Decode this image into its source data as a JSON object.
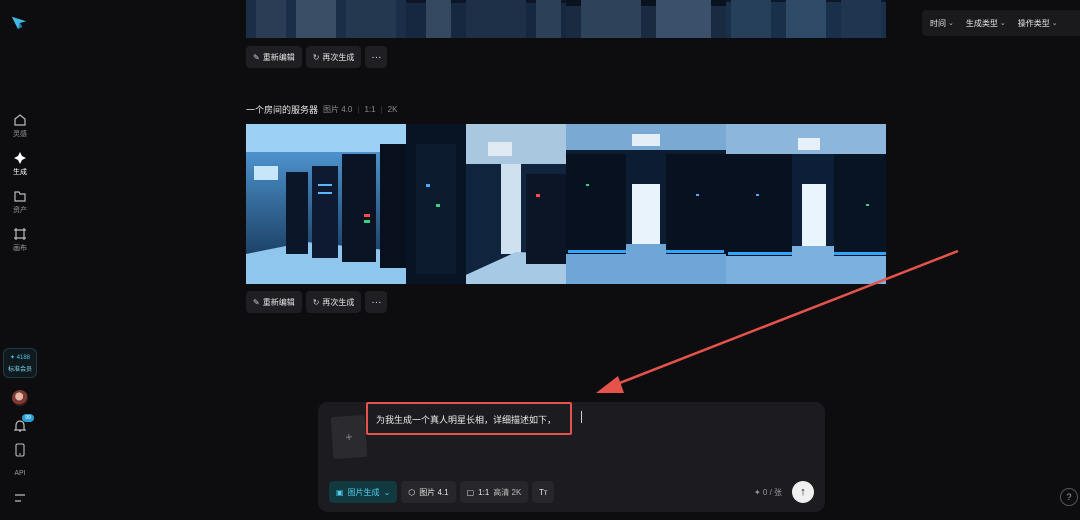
{
  "sidebar": {
    "items": [
      {
        "label": "灵感",
        "icon": "home-icon"
      },
      {
        "label": "生成",
        "icon": "sparkle-icon"
      },
      {
        "label": "资产",
        "icon": "folder-icon"
      },
      {
        "label": "画布",
        "icon": "canvas-icon"
      }
    ],
    "member": {
      "points": "4188",
      "tier": "标准会员"
    },
    "notification_count": "99",
    "api_label": "API"
  },
  "filters": [
    {
      "label": "时间"
    },
    {
      "label": "生成类型"
    },
    {
      "label": "操作类型"
    }
  ],
  "first_group": {
    "actions": {
      "reedit": "重新编辑",
      "regen": "再次生成",
      "more": "···"
    }
  },
  "second_group": {
    "title": "一个房间的服务器",
    "model": "图片 4.0",
    "ratio": "1:1",
    "resolution": "2K",
    "actions": {
      "reedit": "重新编辑",
      "regen": "再次生成",
      "more": "···"
    }
  },
  "composer": {
    "add_symbol": "+",
    "prompt": "为我生成一个真人明星长相，详细描述如下，",
    "mode": "图片生成",
    "model": "图片 4.1",
    "ratio": "1:1",
    "quality": "高清 2K",
    "counter": "✦ 0 / 张",
    "send_symbol": "↑"
  },
  "help_symbol": "?",
  "colors": {
    "accent": "#4fd0ee",
    "annotation": "#e5534b",
    "background": "#0d0d0f"
  }
}
